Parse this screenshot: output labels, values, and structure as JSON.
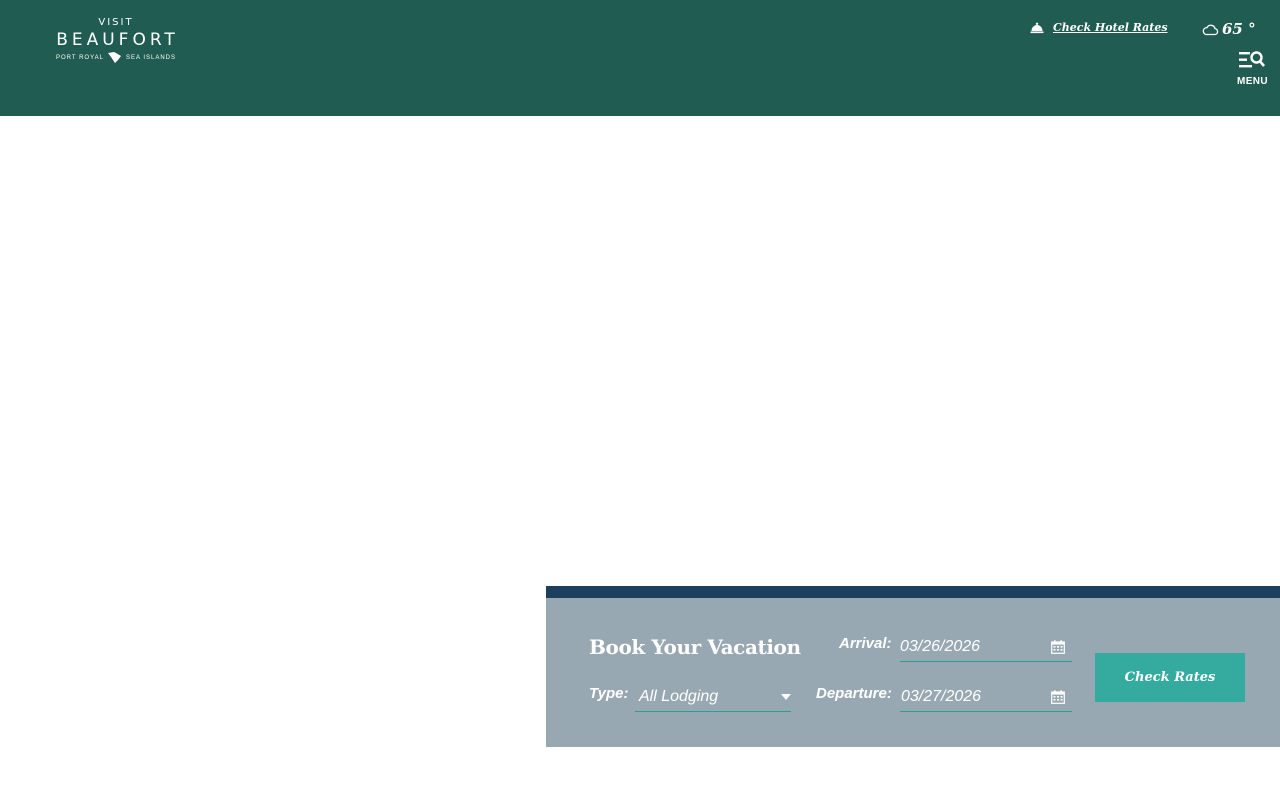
{
  "header": {
    "logo": {
      "visit": "VISIT",
      "name": "BEAUFORT",
      "sub_left": "PORT ROYAL",
      "sub_right": "SEA ISLANDS"
    },
    "hotel_link_label": "Check Hotel Rates",
    "hotel_icon": "service-bell-icon",
    "weather": {
      "icon": "cloud-icon",
      "temperature": "65 °"
    },
    "menu": {
      "label": "MENU",
      "icon": "menu-search-icon"
    },
    "background_color": "#215c52"
  },
  "booking": {
    "title": "Book Your Vacation",
    "type_label": "Type:",
    "type_value": "All Lodging",
    "arrival_label": "Arrival:",
    "arrival_value": "03/26/2026",
    "departure_label": "Departure:",
    "departure_value": "03/27/2026",
    "calendar_icon": "calendar-icon",
    "dropdown_icon": "caret-down-icon",
    "submit_label": "Check Rates",
    "panel_color": "#98a8b3",
    "bar_color": "#1d3f5e",
    "button_color": "#35aba0"
  }
}
